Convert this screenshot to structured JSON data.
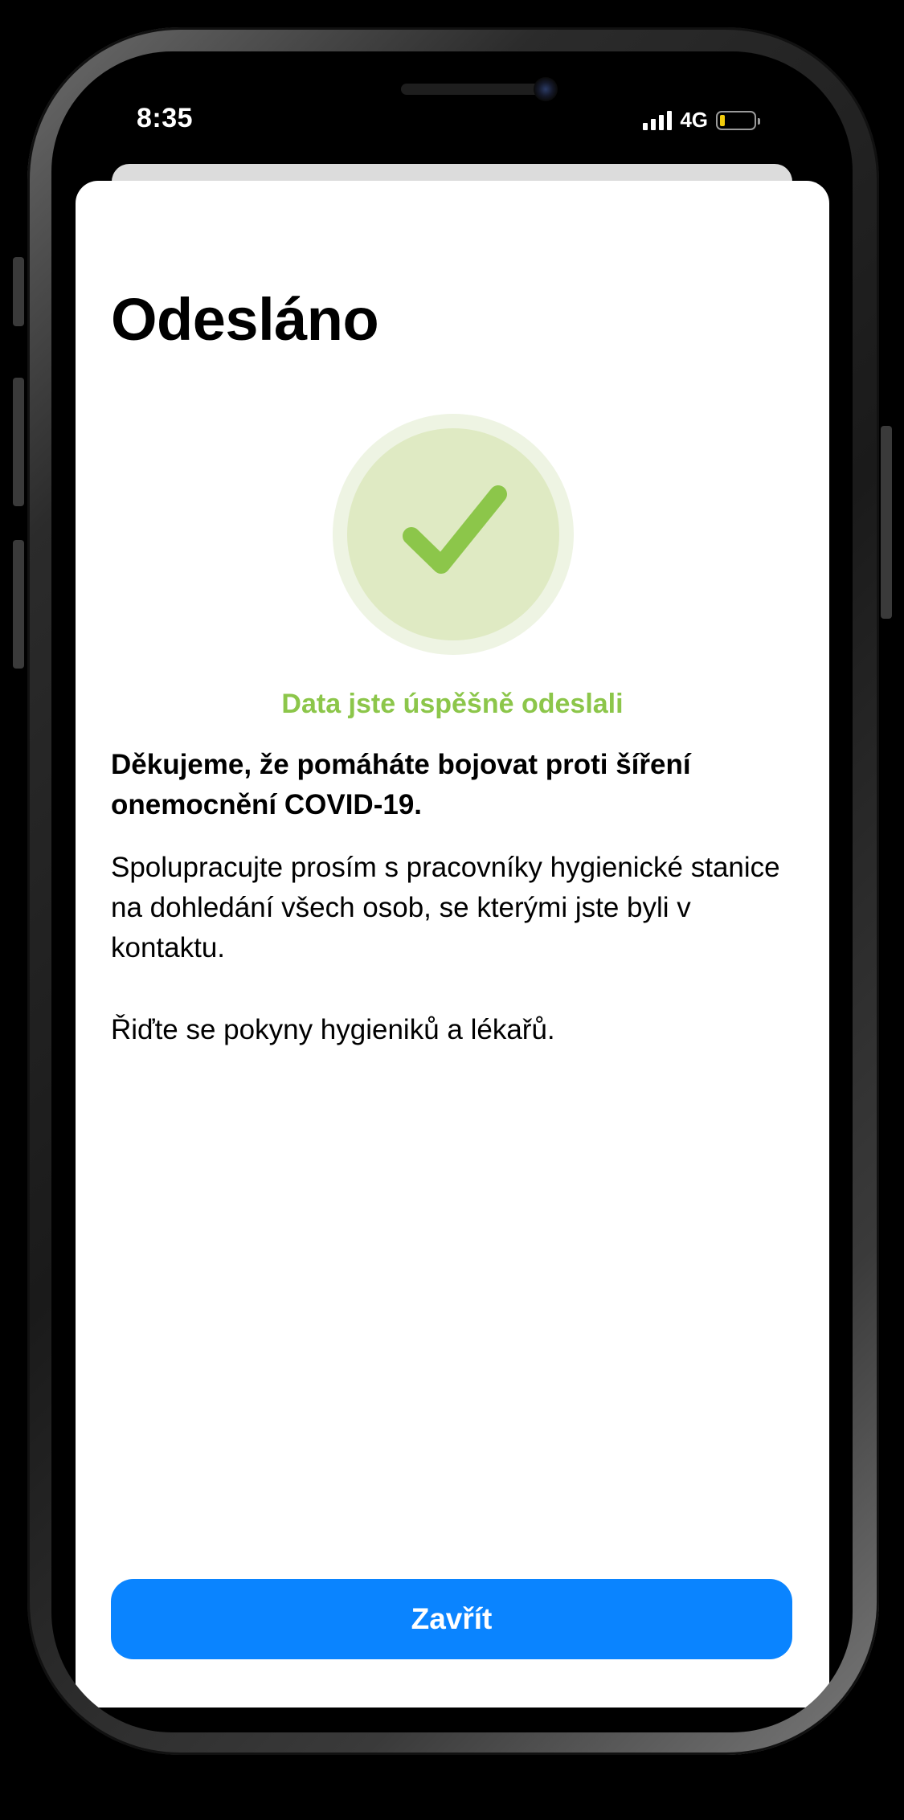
{
  "status_bar": {
    "time": "8:35",
    "network": "4G",
    "icons": [
      "cellular-signal-icon",
      "battery-icon"
    ],
    "battery_level": 0.15,
    "battery_color": "#f2cc0c"
  },
  "screen": {
    "title": "Odesláno",
    "status_icon": "checkmark-icon",
    "success_message": "Data jste úspěšně odeslali",
    "thanks": "Děkujeme, že pomáháte bojovat proti šíření onemocnění COVID-19.",
    "info": "Spolupracujte prosím s pracovníky hygienické stanice na dohledání všech osob, se kterými jste byli v kontaktu.",
    "advice": "Řiďte se pokyny hygieniků a lékařů."
  },
  "actions": {
    "close_label": "Zavřít"
  },
  "colors": {
    "accent": "#0a84ff",
    "success": "#8cc64a",
    "success_bg": "#dfeac3"
  }
}
